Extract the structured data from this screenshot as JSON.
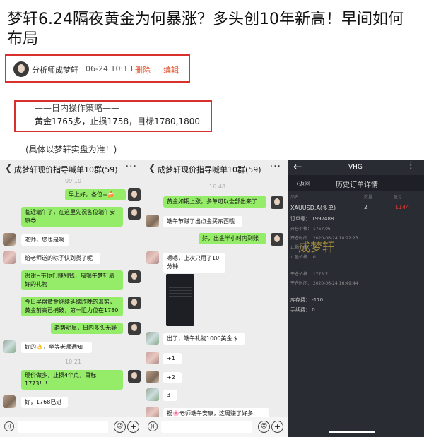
{
  "article": {
    "title": "梦轩6.24隔夜黄金为何暴涨？多头创10年新高！早间如何布局",
    "author": "分析师成梦轩",
    "time": "06-24 10:13",
    "delete_label": "删除",
    "edit_label": "编辑",
    "strategy_title": "——日内操作策略——",
    "strategy_body": "黄金1765多，止损1758，目标1780,1800",
    "disclaimer": "(具体以梦轩实盘为准！)"
  },
  "chat1": {
    "title": "成梦轩现价指导喊单10群(59)",
    "ts1": "09:10",
    "ts2": "10:21",
    "messages": [
      "早上好，各位☕🍰",
      "临近端午了，在这里先祝各位端午安康😎",
      "老师，您也是啊",
      "给老师送的粽子快到货了呢",
      "谢谢~带你们赚到钱，是端午梦轩最好的礼物",
      "今日早盘黄金继续延续昨晚的涨势，黄金前高已捕破，第一阻力位在1780",
      "趋势明显，日内多头无疑",
      "好的👌，坐等老师通知",
      "现价做多，止损4个点，目标1773！！",
      "好，1768已进"
    ]
  },
  "chat2": {
    "title": "成梦轩现价指导喊单10群(59)",
    "ts1": "16:48",
    "messages": [
      "黄金如期上涨，多单可以全部出来了",
      "端午节赚了出点金买东西哦",
      "好，出金半小时内到账",
      "嗯嗯，上次只用了10分钟",
      "出了，端午礼物1000美金 $",
      "+1",
      "+2",
      "3",
      "祝🌸老师端午安康，这周赚了好多"
    ]
  },
  "trade": {
    "app_name": "VHG",
    "back_label": "〈返回",
    "page_title": "历史订单详情",
    "col_product": "品名",
    "col_qty": "数量",
    "col_pnl": "盈亏",
    "product": "XAUUSD.A(多单)",
    "qty": "2",
    "pnl": "1144",
    "order_no": "订单号： 1997488",
    "open_price": "开仓价格： 1767.06",
    "open_time": "开仓时间： 2020-06-24 10:22:23",
    "stop_loss": "止损价格： 0",
    "take_profit": "止盈价格： 0",
    "close_price": "平仓价格： 1773.7",
    "close_time": "平仓时间： 2020-06-24 16:49:44",
    "swap": "库存费： -170",
    "fee": "手续费： 0",
    "watermark": "成梦轩",
    "colors": {
      "profit": "#e03a2e",
      "background": "#2a2c33"
    }
  },
  "icons": [
    "back-icon",
    "more-icon",
    "voice-icon",
    "emoji-icon",
    "plus-icon"
  ]
}
